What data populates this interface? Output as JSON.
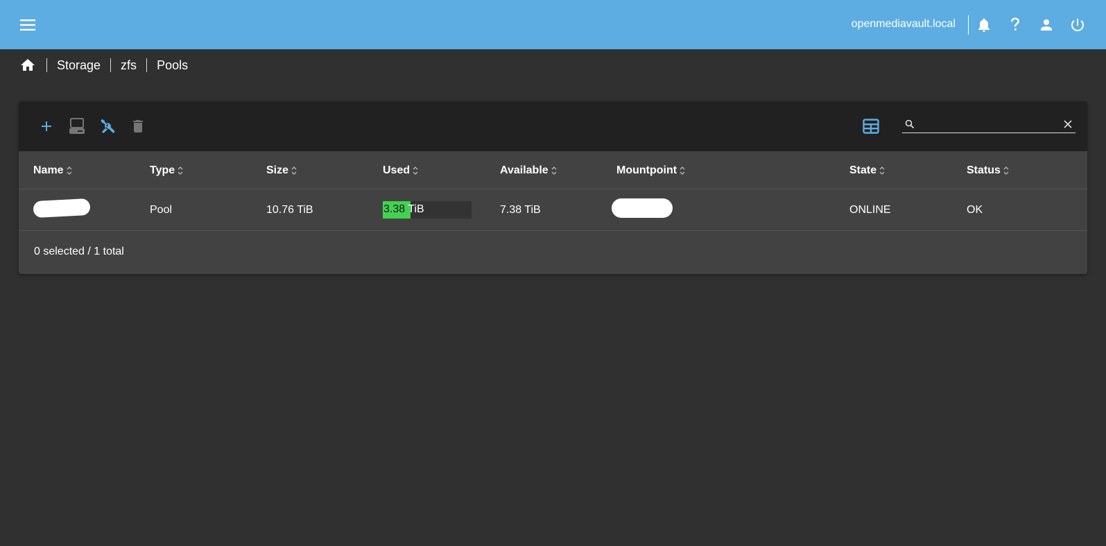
{
  "header": {
    "hostname": "openmediavault.local",
    "icons": [
      "menu-icon",
      "bell-icon",
      "help-icon",
      "user-icon",
      "power-icon"
    ],
    "accent": "#5dade2"
  },
  "breadcrumb": [
    "Storage",
    "zfs",
    "Pools"
  ],
  "toolbar": {
    "tools": [
      "plus-icon",
      "monitor-icon",
      "tools-icon",
      "trash-icon"
    ],
    "search_value": "",
    "search_placeholder": ""
  },
  "table": {
    "columns": [
      "Name",
      "Type",
      "Size",
      "Used",
      "Available",
      "Mountpoint",
      "State",
      "Status"
    ],
    "rows": [
      {
        "name": "",
        "type": "Pool",
        "size": "10.76 TiB",
        "used_num": "3.38",
        "used_unit": " TiB",
        "used_fraction": 0.314,
        "available": "7.38 TiB",
        "mountpoint": "",
        "state": "ONLINE",
        "status": "OK"
      }
    ],
    "footer": "0 selected / 1 total",
    "usage_color": "#42d251"
  }
}
